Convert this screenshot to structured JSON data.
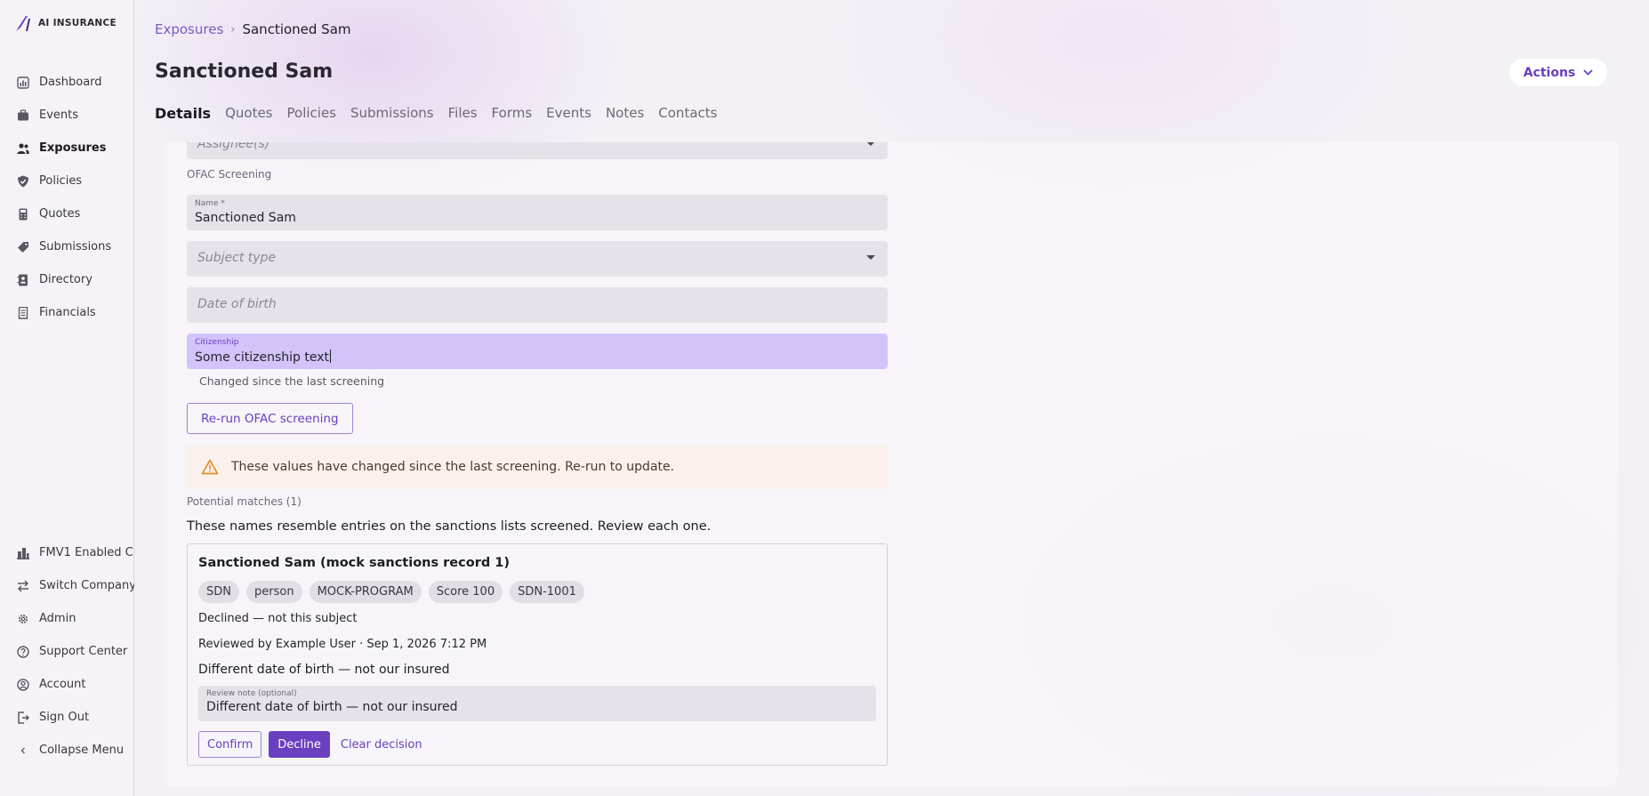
{
  "app": {
    "logo_text": "AI INSURANCE"
  },
  "sidebar": {
    "items": [
      {
        "label": "Dashboard",
        "icon": "chart-icon"
      },
      {
        "label": "Events",
        "icon": "briefcase-icon"
      },
      {
        "label": "Exposures",
        "icon": "people-icon",
        "active": true
      },
      {
        "label": "Policies",
        "icon": "shield-check-icon"
      },
      {
        "label": "Quotes",
        "icon": "calculator-icon"
      },
      {
        "label": "Submissions",
        "icon": "tag-icon"
      },
      {
        "label": "Directory",
        "icon": "address-book-icon"
      },
      {
        "label": "Financials",
        "icon": "receipt-icon"
      }
    ],
    "bottom": [
      {
        "label": "FMV1 Enabled C...",
        "icon": "company-icon"
      },
      {
        "label": "Switch Company",
        "icon": "swap-icon"
      },
      {
        "label": "Admin",
        "icon": "gear-icon"
      },
      {
        "label": "Support Center",
        "icon": "help-icon"
      },
      {
        "label": "Account",
        "icon": "user-circle-icon"
      },
      {
        "label": "Sign Out",
        "icon": "sign-out-icon"
      },
      {
        "label": "Collapse Menu",
        "icon": "chevron-left-icon"
      }
    ]
  },
  "breadcrumb": {
    "parent": "Exposures",
    "current": "Sanctioned Sam"
  },
  "header": {
    "title": "Sanctioned Sam",
    "actions_label": "Actions"
  },
  "tabs": [
    "Details",
    "Quotes",
    "Policies",
    "Submissions",
    "Files",
    "Forms",
    "Events",
    "Notes",
    "Contacts"
  ],
  "form": {
    "assignee_placeholder": "Assignee(s)",
    "section_title": "OFAC Screening",
    "name_label": "Name *",
    "name_value": "Sanctioned Sam",
    "subject_type_placeholder": "Subject type",
    "dob_placeholder": "Date of birth",
    "citizenship_label": "Citizenship",
    "citizenship_value": "Some citizenship text",
    "citizenship_helper": "Changed since the last screening",
    "rerun_label": "Re-run OFAC screening",
    "warning_text": "These values have changed since the last screening. Re-run to update."
  },
  "matches": {
    "heading": "Potential matches (1)",
    "description": "These names resemble entries on the sanctions lists screened. Review each one.",
    "items": [
      {
        "title": "Sanctioned Sam (mock sanctions record 1)",
        "chips": [
          "SDN",
          "person",
          "MOCK-PROGRAM",
          "Score 100",
          "SDN-1001"
        ],
        "status": "Declined — not this subject",
        "reviewed": "Reviewed by Example User · Sep 1, 2026 7:12 PM",
        "note": "Different date of birth — not our insured",
        "note_label": "Review note (optional)",
        "note_value": "Different date of birth — not our insured",
        "confirm_label": "Confirm",
        "decline_label": "Decline",
        "clear_label": "Clear decision"
      }
    ]
  },
  "colors": {
    "accent": "#6a3fc0",
    "focused_field": "#d3c3fb",
    "warning_bg": "#fbf1ec",
    "warning_icon": "#e8892b"
  }
}
